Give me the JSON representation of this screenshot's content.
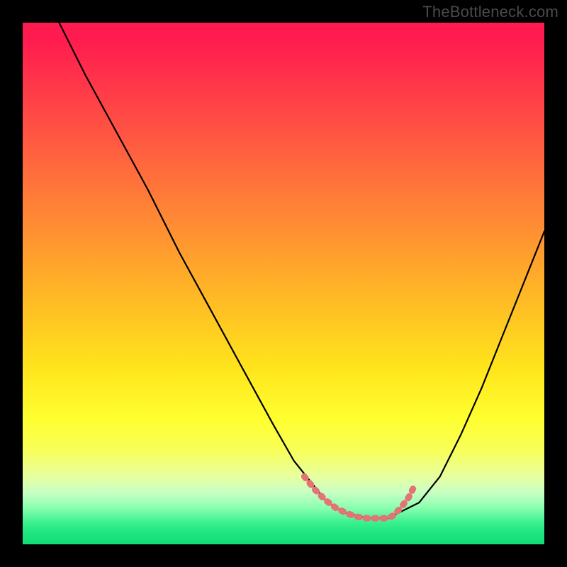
{
  "watermark": "TheBottleneck.com",
  "colors": {
    "frame_bg": "#000000",
    "curve": "#000000",
    "highlight": "#e37374",
    "watermark_text": "#4a4a4a"
  },
  "chart_data": {
    "type": "line",
    "title": "",
    "xlabel": "",
    "ylabel": "",
    "xlim": [
      0,
      100
    ],
    "ylim": [
      0,
      100
    ],
    "note": "Bottleneck-style V-curve. x is normalized horizontal position (0–100). y is normalized vertical position (0=top, 100=bottom). Background vertical gradient encodes bottleneck severity: red(top)=high, green(bottom)=low.",
    "series": [
      {
        "name": "curve",
        "x": [
          7,
          12,
          18,
          24,
          30,
          36,
          42,
          48,
          52,
          56,
          58,
          60,
          62,
          66,
          70,
          72,
          76,
          80,
          84,
          88,
          92,
          96,
          100
        ],
        "y": [
          0,
          10,
          21,
          32,
          44,
          55,
          66,
          77,
          84,
          89,
          91.5,
          93,
          94,
          95,
          95,
          94,
          92,
          87,
          79,
          70,
          60,
          50,
          40
        ]
      },
      {
        "name": "bottom-highlight",
        "x": [
          54,
          56,
          58,
          60,
          62,
          64,
          66,
          68,
          70,
          71,
          72.5,
          74,
          75
        ],
        "y": [
          87,
          89.5,
          91.5,
          93,
          94,
          94.7,
          95,
          95,
          95,
          94.5,
          93,
          91,
          89
        ]
      }
    ],
    "gradient_stops": [
      {
        "pct": 0,
        "color": "#ff1a4f"
      },
      {
        "pct": 22,
        "color": "#ff5742"
      },
      {
        "pct": 53,
        "color": "#ffba25"
      },
      {
        "pct": 76,
        "color": "#ffff2f"
      },
      {
        "pct": 90,
        "color": "#c9ffc3"
      },
      {
        "pct": 100,
        "color": "#13db75"
      }
    ]
  }
}
